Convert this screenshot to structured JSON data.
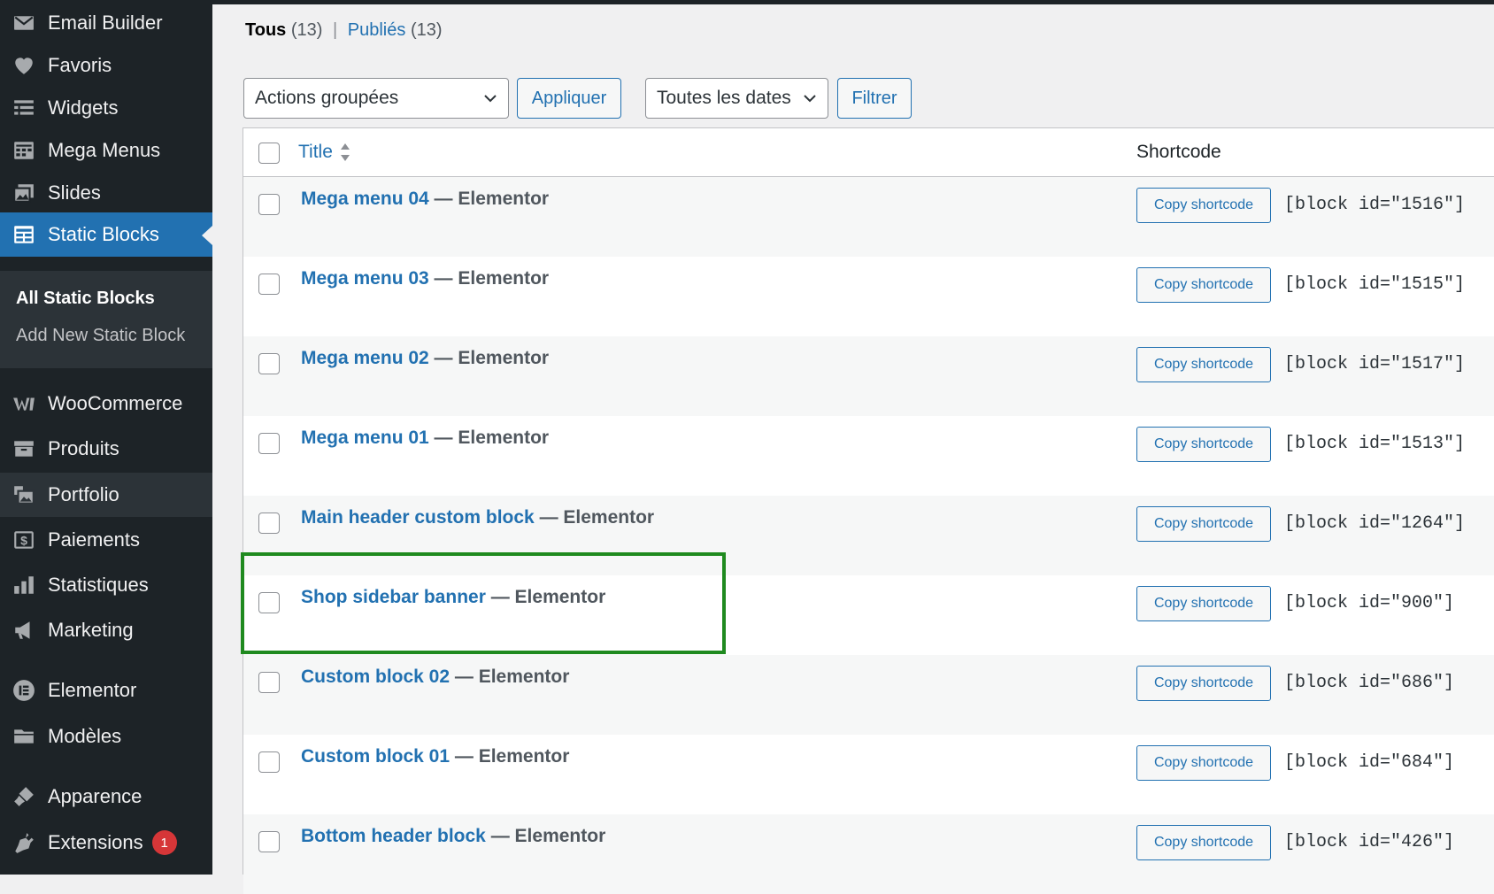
{
  "sidebar": {
    "items": [
      {
        "label": "Email Builder",
        "icon": "email-icon"
      },
      {
        "label": "Favoris",
        "icon": "heart-icon"
      },
      {
        "label": "Widgets",
        "icon": "widgets-icon"
      },
      {
        "label": "Mega Menus",
        "icon": "mega-menu-icon"
      },
      {
        "label": "Slides",
        "icon": "slides-icon"
      },
      {
        "label": "Static Blocks",
        "icon": "static-blocks-icon"
      },
      {
        "label": "WooCommerce",
        "icon": "woocommerce-icon"
      },
      {
        "label": "Produits",
        "icon": "products-icon"
      },
      {
        "label": "Portfolio",
        "icon": "portfolio-icon"
      },
      {
        "label": "Paiements",
        "icon": "payments-icon"
      },
      {
        "label": "Statistiques",
        "icon": "stats-icon"
      },
      {
        "label": "Marketing",
        "icon": "megaphone-icon"
      },
      {
        "label": "Elementor",
        "icon": "elementor-icon"
      },
      {
        "label": "Modèles",
        "icon": "folder-icon"
      },
      {
        "label": "Apparence",
        "icon": "brush-icon"
      },
      {
        "label": "Extensions",
        "icon": "plugin-icon",
        "badge": "1"
      }
    ],
    "submenu": [
      "All Static Blocks",
      "Add New Static Block"
    ]
  },
  "views": {
    "all_label": "Tous",
    "all_count": "(13)",
    "separator": "|",
    "published_label": "Publiés",
    "published_count": "(13)"
  },
  "filters": {
    "bulk_actions": "Actions groupées",
    "apply": "Appliquer",
    "dates": "Toutes les dates",
    "filter": "Filtrer"
  },
  "table": {
    "col_title": "Title",
    "col_shortcode": "Shortcode",
    "copy_label": "Copy shortcode",
    "rows": [
      {
        "title": "Mega menu 04",
        "state": " — Elementor",
        "code": "[block id=\"1516\"]"
      },
      {
        "title": "Mega menu 03",
        "state": " — Elementor",
        "code": "[block id=\"1515\"]"
      },
      {
        "title": "Mega menu 02",
        "state": " — Elementor",
        "code": "[block id=\"1517\"]"
      },
      {
        "title": "Mega menu 01",
        "state": " — Elementor",
        "code": "[block id=\"1513\"]"
      },
      {
        "title": "Main header custom block",
        "state": " — Elementor",
        "code": "[block id=\"1264\"]"
      },
      {
        "title": "Shop sidebar banner",
        "state": " — Elementor",
        "code": "[block id=\"900\"]"
      },
      {
        "title": "Custom block 02",
        "state": " — Elementor",
        "code": "[block id=\"686\"]"
      },
      {
        "title": "Custom block 01",
        "state": " — Elementor",
        "code": "[block id=\"684\"]"
      },
      {
        "title": "Bottom header block",
        "state": " — Elementor",
        "code": "[block id=\"426\"]"
      }
    ]
  },
  "colors": {
    "accent": "#2271b1",
    "sidebar": "#1d2327",
    "highlight": "#1f8a1f"
  }
}
